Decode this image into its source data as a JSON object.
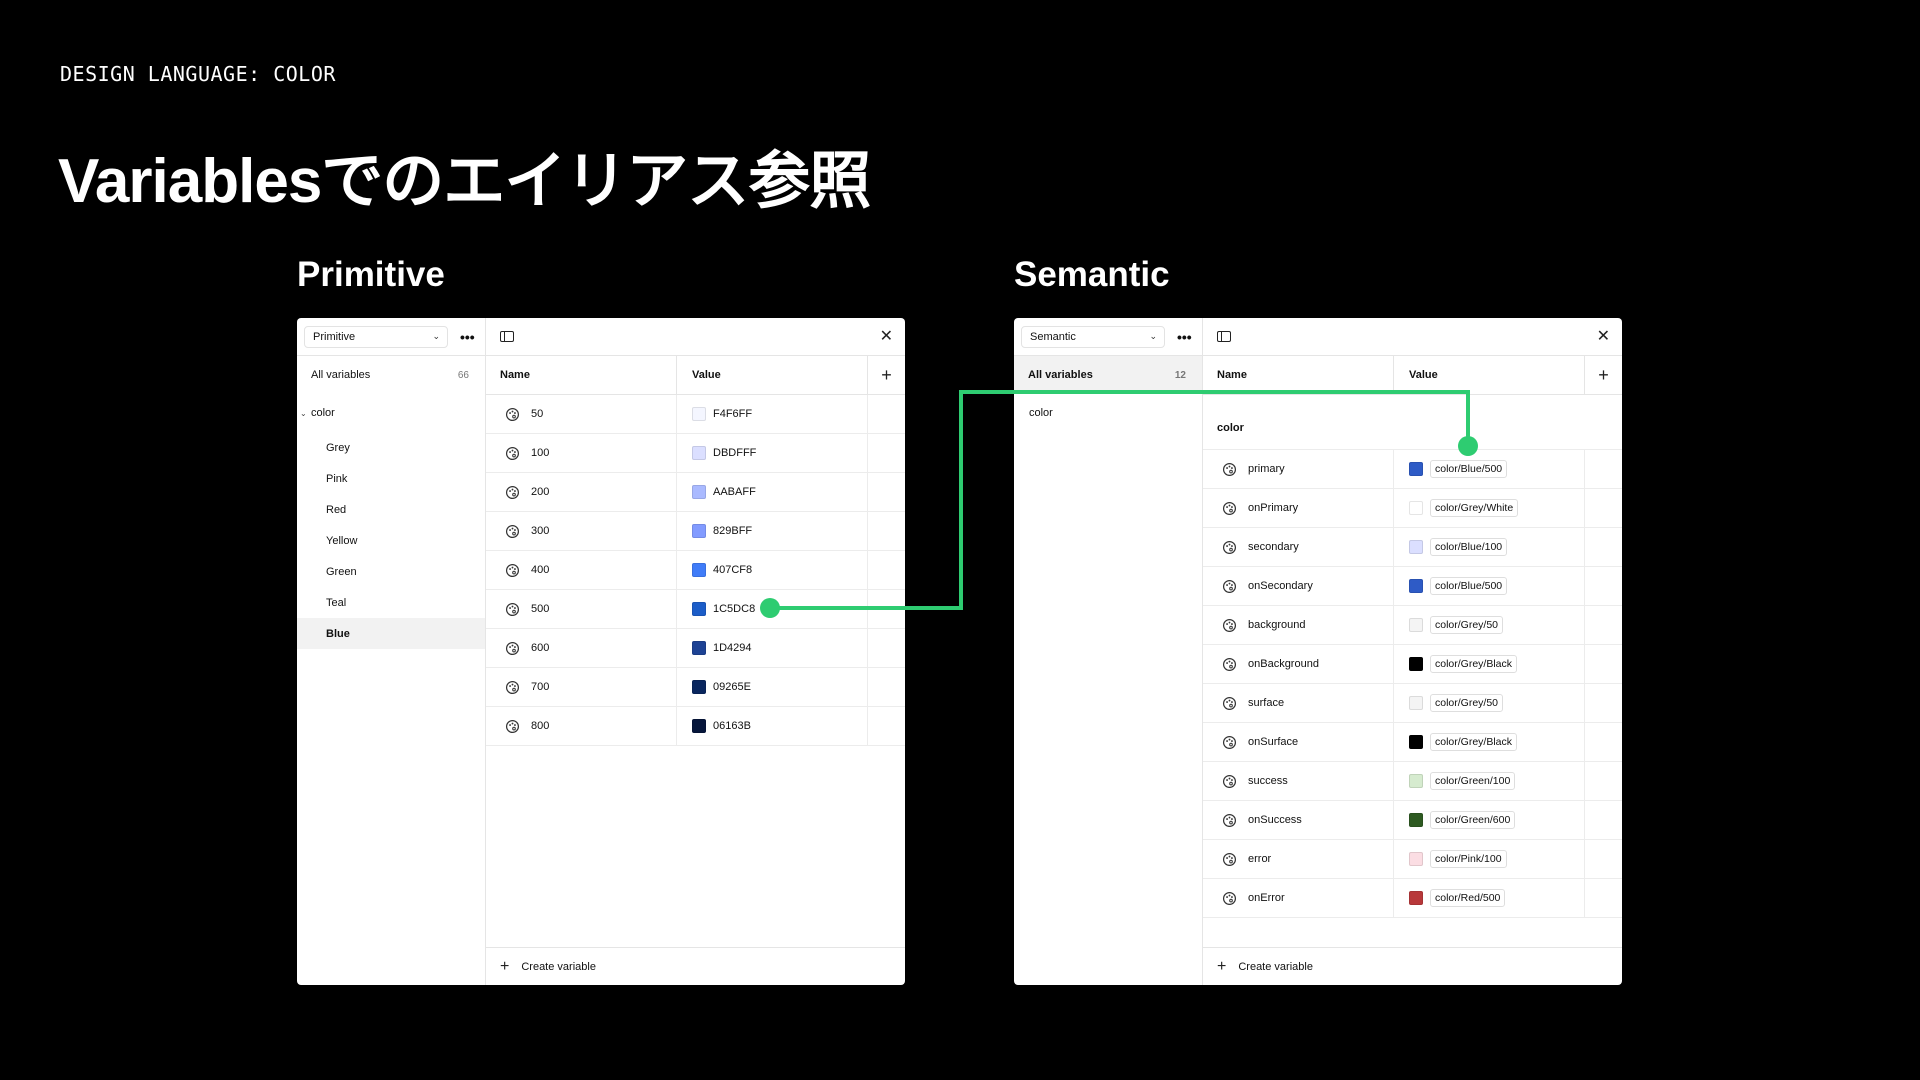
{
  "slide": {
    "eyebrow": "DESIGN LANGUAGE: COLOR",
    "title": "Variablesでのエイリアス参照"
  },
  "primitive": {
    "section_label": "Primitive",
    "collection": "Primitive",
    "all_variables": "All variables",
    "count": "66",
    "group": "color",
    "groups": [
      "Grey",
      "Pink",
      "Red",
      "Yellow",
      "Green",
      "Teal",
      "Blue"
    ],
    "active_group": "Blue",
    "col_name": "Name",
    "col_value": "Value",
    "rows": [
      {
        "name": "50",
        "value": "F4F6FF",
        "color": "#F4F6FF"
      },
      {
        "name": "100",
        "value": "DBDFFF",
        "color": "#DBDFFF"
      },
      {
        "name": "200",
        "value": "AABAFF",
        "color": "#AABAFF"
      },
      {
        "name": "300",
        "value": "829BFF",
        "color": "#829BFF"
      },
      {
        "name": "400",
        "value": "407CF8",
        "color": "#407CF8"
      },
      {
        "name": "500",
        "value": "1C5DC8",
        "color": "#1C5DC8"
      },
      {
        "name": "600",
        "value": "1D4294",
        "color": "#1D4294"
      },
      {
        "name": "700",
        "value": "09265E",
        "color": "#09265E"
      },
      {
        "name": "800",
        "value": "06163B",
        "color": "#06163B"
      }
    ],
    "create_label": "Create variable"
  },
  "semantic": {
    "section_label": "Semantic",
    "collection": "Semantic",
    "all_variables": "All variables",
    "count": "12",
    "group": "color",
    "col_name": "Name",
    "col_value": "Value",
    "group_title": "color",
    "rows": [
      {
        "name": "primary",
        "value": "color/Blue/500",
        "color": "#2E5BC6"
      },
      {
        "name": "onPrimary",
        "value": "color/Grey/White",
        "color": "#FFFFFF"
      },
      {
        "name": "secondary",
        "value": "color/Blue/100",
        "color": "#DBDFFF"
      },
      {
        "name": "onSecondary",
        "value": "color/Blue/500",
        "color": "#2E5BC6"
      },
      {
        "name": "background",
        "value": "color/Grey/50",
        "color": "#F4F4F4"
      },
      {
        "name": "onBackground",
        "value": "color/Grey/Black",
        "color": "#000000"
      },
      {
        "name": "surface",
        "value": "color/Grey/50",
        "color": "#F4F4F4"
      },
      {
        "name": "onSurface",
        "value": "color/Grey/Black",
        "color": "#000000"
      },
      {
        "name": "success",
        "value": "color/Green/100",
        "color": "#D6EBCF"
      },
      {
        "name": "onSuccess",
        "value": "color/Green/600",
        "color": "#2E5A22"
      },
      {
        "name": "error",
        "value": "color/Pink/100",
        "color": "#FBDDE3"
      },
      {
        "name": "onError",
        "value": "color/Red/500",
        "color": "#B8383A"
      }
    ],
    "create_label": "Create variable"
  },
  "connector_color": "#2ECC71"
}
